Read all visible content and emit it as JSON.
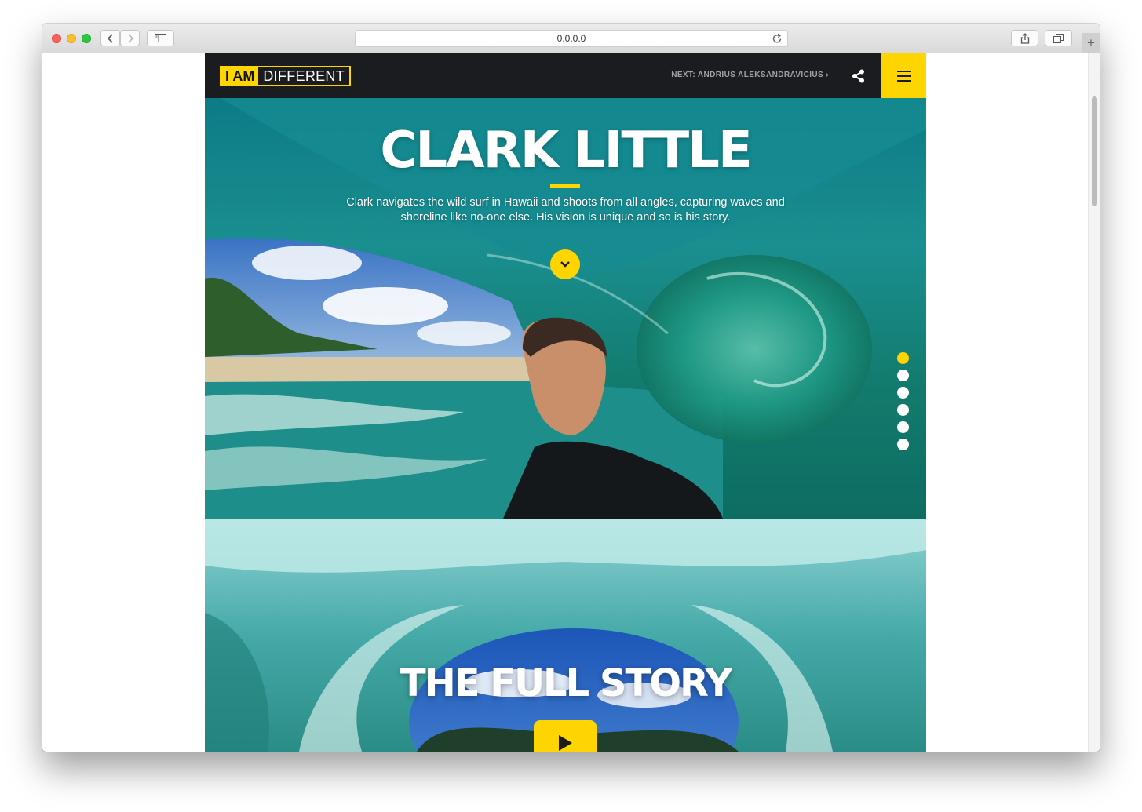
{
  "browser": {
    "url": "0.0.0.0",
    "new_tab_label": "+"
  },
  "site": {
    "logo": {
      "part_a": "I AM",
      "part_b": "DIFFERENT"
    },
    "next_link": "NEXT: ANDRIUS ALEKSANDRAVICIUS ›",
    "share_icon": "share-icon",
    "menu_icon": "hamburger-menu-icon",
    "accent_color": "#ffd500",
    "header_color": "#1b1c20"
  },
  "hero": {
    "title": "CLARK LITTLE",
    "description": "Clark navigates the wild surf in Hawaii and shoots from all angles, capturing waves and shoreline like no-one else. His vision is unique and so is his story.",
    "scroll_icon": "chevron-down-icon",
    "pagination": {
      "count": 6,
      "active_index": 0
    }
  },
  "story": {
    "title": "THE FULL STORY",
    "play_icon": "play-icon"
  }
}
